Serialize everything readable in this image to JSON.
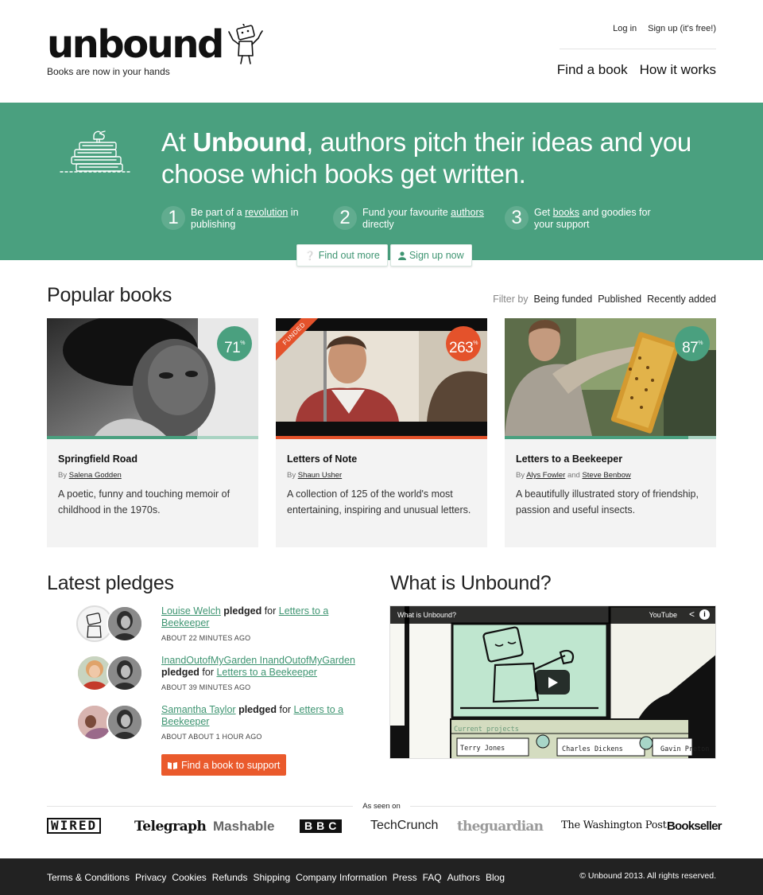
{
  "header": {
    "logo_text": "unbound",
    "tagline": "Books are now in your hands",
    "login": "Log in",
    "signup": "Sign up (it's free!)",
    "nav": [
      "Find a book",
      "How it works"
    ]
  },
  "hero": {
    "headline_prefix": "At ",
    "headline_brand": "Unbound",
    "headline_rest": ", authors pitch their ideas and you choose which books get written.",
    "steps": [
      {
        "num": "1",
        "pre": "Be part of a ",
        "link": "revolution",
        "post": " in publishing"
      },
      {
        "num": "2",
        "pre": "Fund your favourite ",
        "link": "authors",
        "post": " directly"
      },
      {
        "num": "3",
        "pre": "Get ",
        "link": "books",
        "post": " and goodies for your support"
      }
    ],
    "find_out_more": "Find out more",
    "sign_up_now": "Sign up now"
  },
  "popular": {
    "title": "Popular books",
    "filter_label": "Filter by",
    "filters": [
      "Being funded",
      "Published",
      "Recently added"
    ],
    "books": [
      {
        "title": "Springfield Road",
        "by": "By",
        "authors": [
          "Salena Godden"
        ],
        "desc": "A poetic, funny and touching memoir of childhood in the 1970s.",
        "percent": 71,
        "pct_label": "71",
        "funded": false
      },
      {
        "title": "Letters of Note",
        "by": "By",
        "authors": [
          "Shaun Usher"
        ],
        "desc": "A collection of 125 of the world's most entertaining, inspiring and unusual letters.",
        "percent": 263,
        "pct_label": "263",
        "funded": true,
        "funded_label": "FUNDED"
      },
      {
        "title": "Letters to a Beekeeper",
        "by": "By",
        "authors": [
          "Alys Fowler",
          "Steve Benbow"
        ],
        "and": "and",
        "desc": "A beautifully illustrated story of friendship, passion and useful insects.",
        "percent": 87,
        "pct_label": "87",
        "funded": false
      }
    ],
    "percent_sign": "%"
  },
  "pledges": {
    "title": "Latest pledges",
    "pledged": "pledged",
    "for": "for",
    "items": [
      {
        "user": "Louise Welch",
        "book": "Letters to a Beekeeper",
        "time": "ABOUT 22 MINUTES AGO"
      },
      {
        "user": "InandOutofMyGarden InandOutofMyGarden",
        "book": "Letters to a Beekeeper",
        "time": "ABOUT 39 MINUTES AGO"
      },
      {
        "user": "Samantha Taylor",
        "book": "Letters to a Beekeeper",
        "time": "ABOUT ABOUT 1 HOUR AGO"
      }
    ],
    "cta": "Find a book to support"
  },
  "video": {
    "section_title": "What is Unbound?",
    "title": "What is Unbound?",
    "youtube": "YouTube",
    "current_projects": "Current projects",
    "names": [
      "Terry Jones",
      "Charles Dickens",
      "Gavin Preton"
    ]
  },
  "press": {
    "label": "As seen on",
    "logos": [
      "WIRED",
      "Telegraph",
      "Mashable",
      "BBC",
      "TechCrunch",
      "theguardian",
      "The Washington Post",
      "Bookseller"
    ]
  },
  "footer": {
    "links": [
      "Terms & Conditions",
      "Privacy",
      "Cookies",
      "Refunds",
      "Shipping",
      "Company Information",
      "Press",
      "FAQ",
      "Authors",
      "Blog"
    ],
    "copyright": "© Unbound 2013. All rights reserved."
  },
  "colors": {
    "brand_green": "#4aa07f",
    "accent_orange": "#e4522b",
    "footer_dark": "#222222"
  }
}
